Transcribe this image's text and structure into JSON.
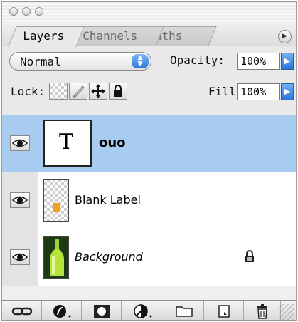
{
  "tabs": [
    {
      "label": "Layers"
    },
    {
      "label": "Channels"
    },
    {
      "label": "Paths"
    }
  ],
  "blend_mode": {
    "value": "Normal"
  },
  "opacity": {
    "label": "Opacity:",
    "value": "100%"
  },
  "lock": {
    "label": "Lock:"
  },
  "fill": {
    "label": "Fill:",
    "value": "100%"
  },
  "layers": [
    {
      "name": "ouo",
      "type": "text",
      "thumb_glyph": "T",
      "selected": true,
      "visible": true
    },
    {
      "name": "Blank Label",
      "type": "pixel",
      "selected": false,
      "visible": true
    },
    {
      "name": "Background",
      "type": "background",
      "selected": false,
      "visible": true,
      "locked": true
    }
  ],
  "colors": {
    "selection": "#a8ccf0",
    "accent": "#2f77d8"
  }
}
